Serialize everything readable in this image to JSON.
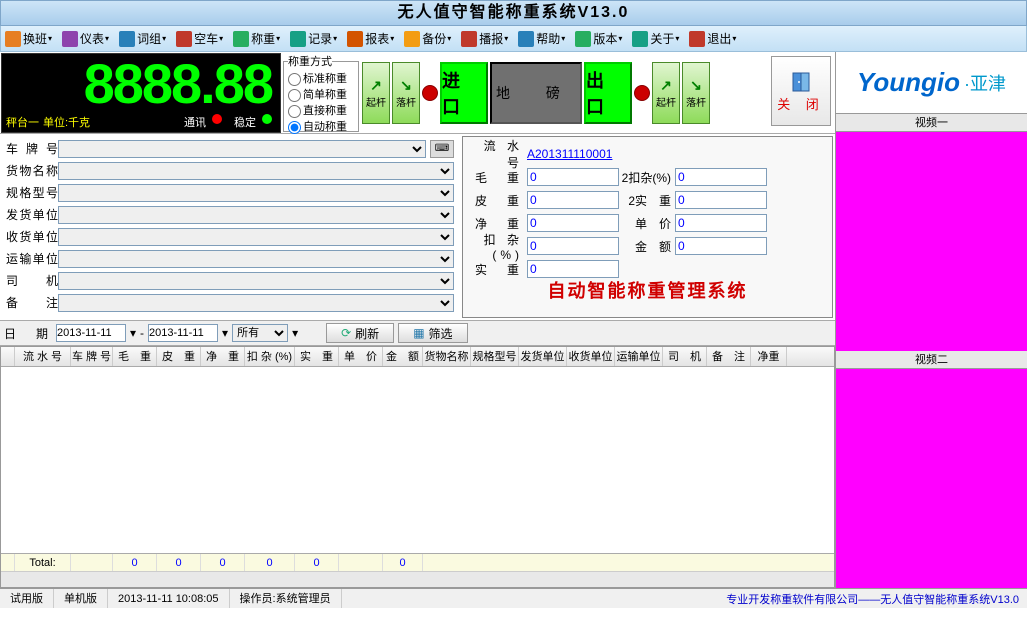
{
  "title": "无人值守智能称重系统V13.0",
  "toolbar": [
    {
      "icon": "#e67e22",
      "label": "换班"
    },
    {
      "icon": "#8e44ad",
      "label": "仪表"
    },
    {
      "icon": "#2980b9",
      "label": "词组"
    },
    {
      "icon": "#c0392b",
      "label": "空车"
    },
    {
      "icon": "#27ae60",
      "label": "称重"
    },
    {
      "icon": "#16a085",
      "label": "记录"
    },
    {
      "icon": "#d35400",
      "label": "报表"
    },
    {
      "icon": "#f39c12",
      "label": "备份"
    },
    {
      "icon": "#c0392b",
      "label": "播报"
    },
    {
      "icon": "#2980b9",
      "label": "帮助"
    },
    {
      "icon": "#27ae60",
      "label": "版本"
    },
    {
      "icon": "#16a085",
      "label": "关于"
    },
    {
      "icon": "#c0392b",
      "label": "退出"
    }
  ],
  "display": {
    "value": "8888.88",
    "scale": "秤台一",
    "unit_label": "单位:千克",
    "comm": "通讯",
    "stable": "稳定"
  },
  "mode": {
    "legend": "称重方式",
    "opts": [
      "标准称重",
      "简单称重",
      "直接称重",
      "自动称重"
    ],
    "selected": 3
  },
  "gates": {
    "up": "起杆",
    "down": "落杆",
    "in": "进 口",
    "out": "出 口",
    "ground": "地 磅"
  },
  "close_label": "关 闭",
  "form_labels": [
    "车 牌 号",
    "货物名称",
    "规格型号",
    "发货单位",
    "收货单位",
    "运输单位",
    "司　机",
    "备　注"
  ],
  "serial": {
    "label": "流 水 号",
    "value": "A201311110001"
  },
  "weights": [
    {
      "l1": "毛　重",
      "v1": "0",
      "l2": "2扣杂(%)",
      "v2": "0"
    },
    {
      "l1": "皮　重",
      "v1": "0",
      "l2": "2实　重",
      "v2": "0"
    },
    {
      "l1": "净　重",
      "v1": "0",
      "l2": "单　价",
      "v2": "0"
    },
    {
      "l1": "扣 杂(%)",
      "v1": "0",
      "l2": "金　额",
      "v2": "0"
    },
    {
      "l1": "实　重",
      "v1": "0"
    }
  ],
  "sys_name": "自动智能称重管理系统",
  "filter": {
    "date_label": "日　期",
    "d1": "2013-11-11",
    "d2": "2013-11-11",
    "all": "所有",
    "refresh": "刷新",
    "sift": "筛选"
  },
  "grid_cols": [
    "",
    "流 水 号",
    "车 牌 号",
    "毛　重",
    "皮　重",
    "净　重",
    "扣 杂 (%)",
    "实　重",
    "单　价",
    "金　额",
    "货物名称",
    "规格型号",
    "发货单位",
    "收货单位",
    "运输单位",
    "司　机",
    "备　注",
    "净重"
  ],
  "grid_w": [
    14,
    56,
    42,
    44,
    44,
    44,
    50,
    44,
    44,
    40,
    48,
    48,
    48,
    48,
    48,
    44,
    44,
    36
  ],
  "totals": {
    "label": "Total:",
    "vals": [
      "0",
      "0",
      "0",
      "0",
      "0",
      "0"
    ]
  },
  "logo": {
    "main": "Youngio",
    "suffix": "·亚津"
  },
  "video1": "视频一",
  "video2": "视频二",
  "status": {
    "trial": "试用版",
    "mode": "单机版",
    "time": "2013-11-11 10:08:05",
    "operator_label": "操作员:",
    "operator": "系统管理员",
    "right": "专业开发称重软件有限公司——无人值守智能称重系统V13.0"
  }
}
